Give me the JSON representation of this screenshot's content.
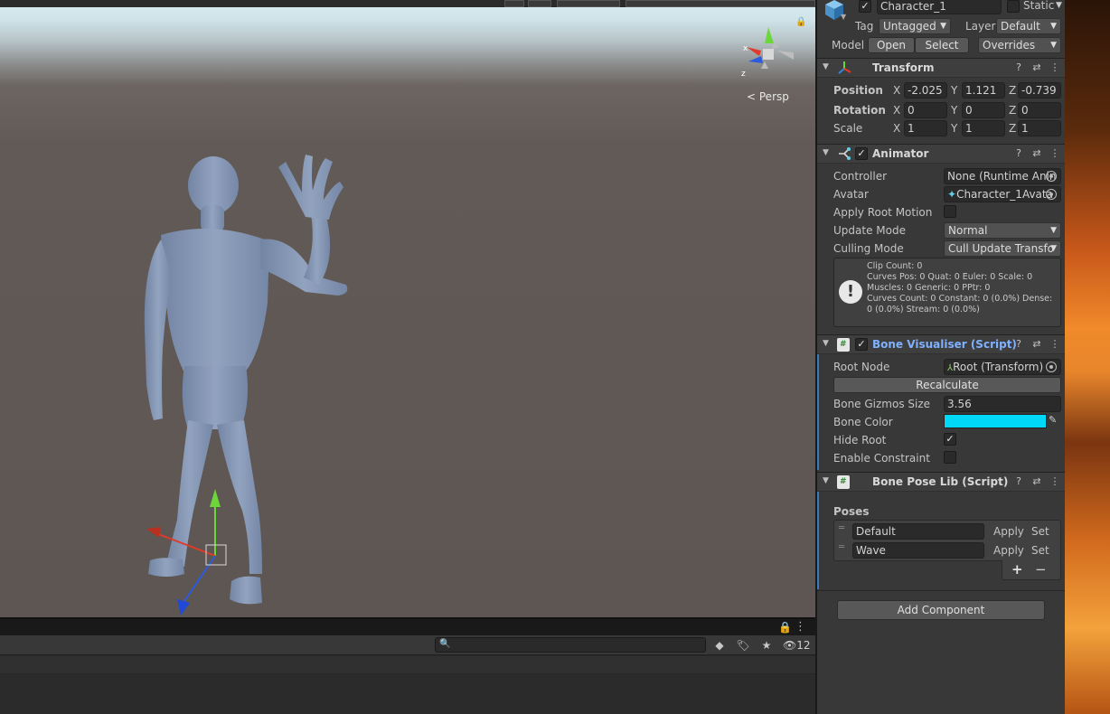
{
  "scene": {
    "persp_label": "Persp",
    "gizmo_axes": {
      "x": "x",
      "z": "z"
    }
  },
  "console": {
    "search": {
      "value": "",
      "placeholder": ""
    },
    "hidden_count": "12"
  },
  "inspector": {
    "header": {
      "object_name": "Character_1",
      "active": true,
      "static_label": "Static",
      "tag_label": "Tag",
      "tag_value": "Untagged",
      "layer_label": "Layer",
      "layer_value": "Default",
      "model_label": "Model",
      "open_label": "Open",
      "select_label": "Select",
      "overrides_label": "Overrides"
    },
    "transform": {
      "title": "Transform",
      "position_label": "Position",
      "rotation_label": "Rotation",
      "scale_label": "Scale",
      "axis_x": "X",
      "axis_y": "Y",
      "axis_z": "Z",
      "position": {
        "x": "-2.025",
        "y": "1.121",
        "z": "-0.739"
      },
      "rotation": {
        "x": "0",
        "y": "0",
        "z": "0"
      },
      "scale": {
        "x": "1",
        "y": "1",
        "z": "1"
      }
    },
    "animator": {
      "title": "Animator",
      "controller_label": "Controller",
      "controller_value": "None (Runtime Anin",
      "avatar_label": "Avatar",
      "avatar_value": "Character_1Avata",
      "apply_root_motion_label": "Apply Root Motion",
      "apply_root_motion": false,
      "update_mode_label": "Update Mode",
      "update_mode_value": "Normal",
      "culling_mode_label": "Culling Mode",
      "culling_mode_value": "Cull Update Transfo",
      "info_lines": [
        "Clip Count: 0",
        "Curves Pos: 0 Quat: 0 Euler: 0 Scale: 0",
        "Muscles: 0 Generic: 0 PPtr: 0",
        "Curves Count: 0 Constant: 0 (0.0%) Dense:",
        "0 (0.0%) Stream: 0 (0.0%)"
      ]
    },
    "bone_visualiser": {
      "title": "Bone Visualiser (Script)",
      "root_node_label": "Root Node",
      "root_node_value": "Root (Transform)",
      "recalculate_label": "Recalculate",
      "gizmo_size_label": "Bone Gizmos Size",
      "gizmo_size_value": "3.56",
      "bone_color_label": "Bone Color",
      "bone_color": "#00d8f8",
      "hide_root_label": "Hide Root",
      "hide_root": true,
      "enable_constraint_label": "Enable Constraint",
      "enable_constraint": false
    },
    "bone_pose_lib": {
      "title": "Bone Pose Lib (Script)",
      "poses_label": "Poses",
      "apply_label": "Apply",
      "set_label": "Set",
      "poses": [
        {
          "name": "Default"
        },
        {
          "name": "Wave"
        }
      ],
      "add_label": "+",
      "remove_label": "−"
    },
    "add_component_label": "Add Component"
  },
  "colors": {
    "accent_blue": "#3a79bb",
    "script_title_blue": "#7fb1ff",
    "figure_color": "#8a9bb7"
  },
  "icons": [
    "lock-icon",
    "more-icon",
    "help-icon",
    "preset-icon",
    "search-icon",
    "warning-icon",
    "eyedropper-icon",
    "checkmark-icon",
    "cube-icon",
    "transform-icon",
    "animator-icon",
    "script-icon",
    "avatar-icon",
    "target-icon"
  ]
}
